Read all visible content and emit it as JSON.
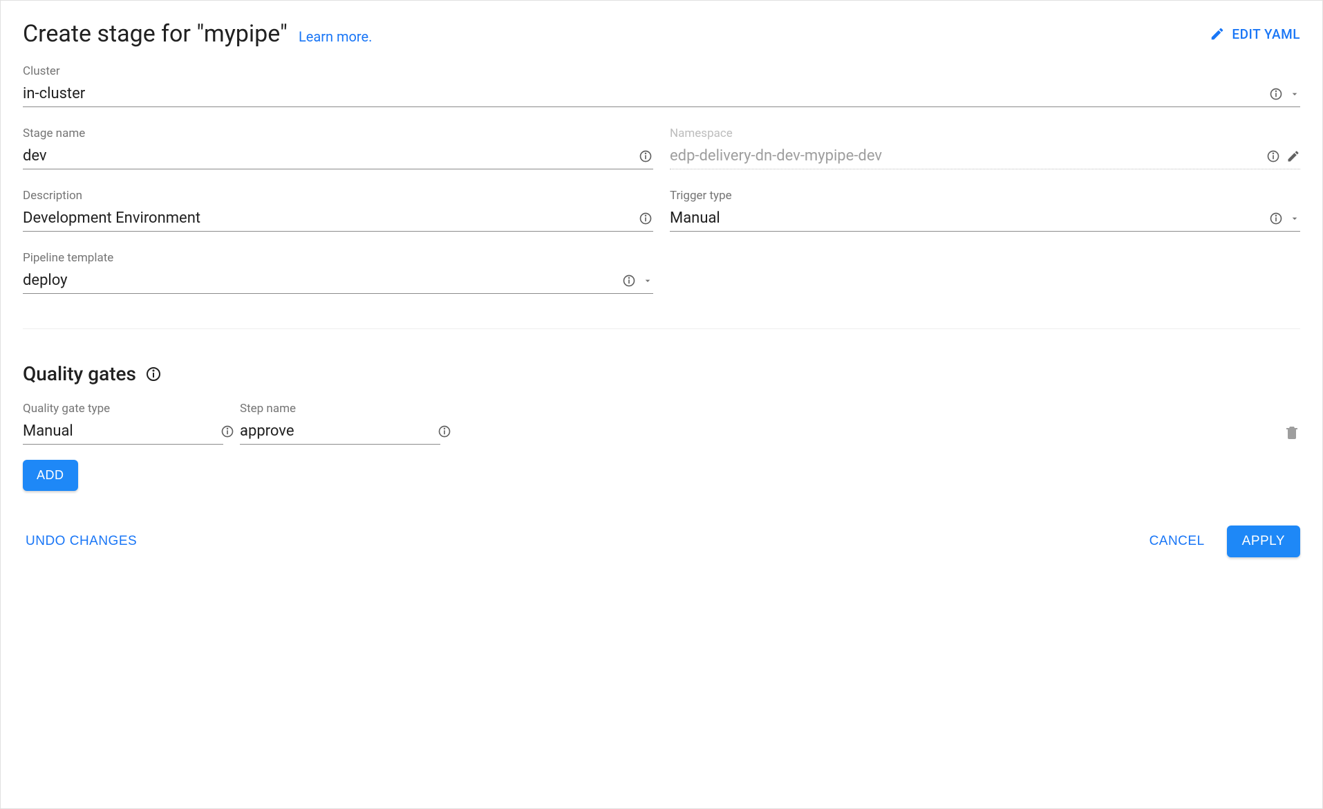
{
  "header": {
    "title": "Create stage for \"mypipe\"",
    "learn_more": "Learn more.",
    "edit_yaml": "EDIT YAML"
  },
  "fields": {
    "cluster": {
      "label": "Cluster",
      "value": "in-cluster"
    },
    "stage_name": {
      "label": "Stage name",
      "value": "dev"
    },
    "namespace": {
      "label": "Namespace",
      "value": "edp-delivery-dn-dev-mypipe-dev"
    },
    "description": {
      "label": "Description",
      "value": "Development Environment"
    },
    "trigger_type": {
      "label": "Trigger type",
      "value": "Manual"
    },
    "pipeline_template": {
      "label": "Pipeline template",
      "value": "deploy"
    }
  },
  "quality_gates": {
    "title": "Quality gates",
    "type_label": "Quality gate type",
    "step_label": "Step name",
    "rows": [
      {
        "type": "Manual",
        "step": "approve"
      }
    ],
    "add_label": "ADD"
  },
  "footer": {
    "undo": "UNDO CHANGES",
    "cancel": "CANCEL",
    "apply": "APPLY"
  }
}
